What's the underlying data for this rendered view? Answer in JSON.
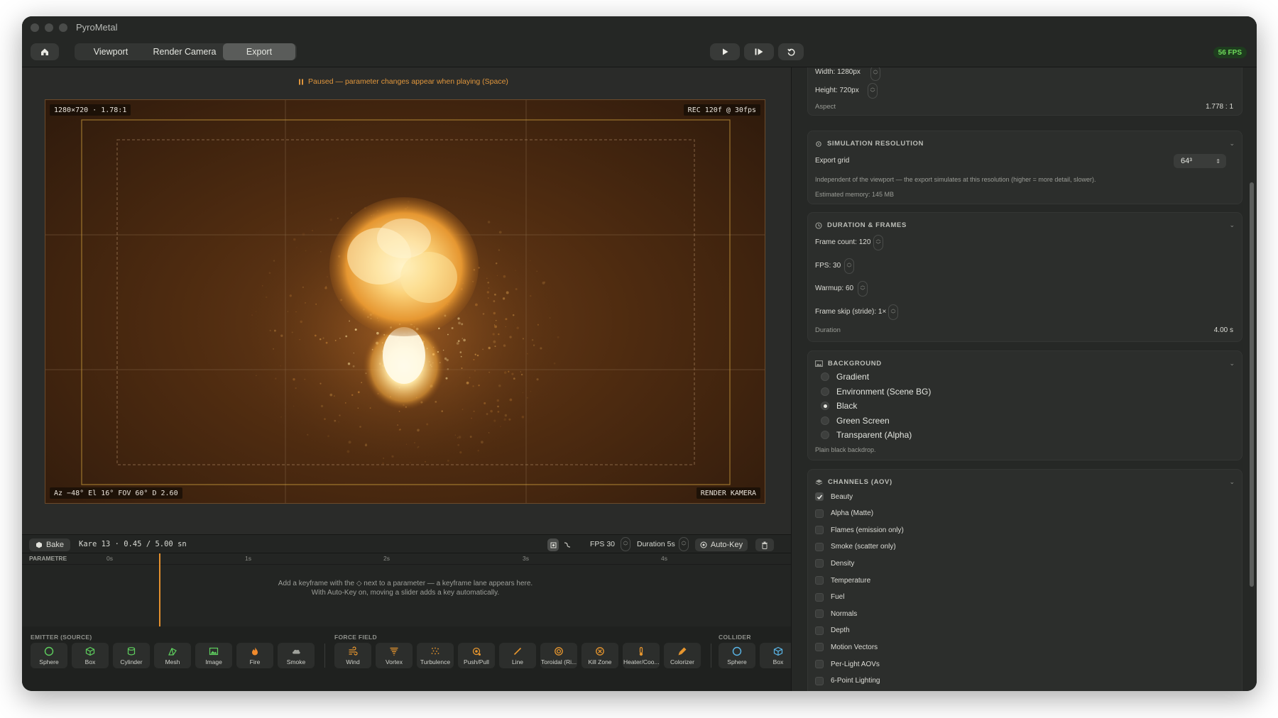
{
  "window": {
    "title": "PyroMetal"
  },
  "toolbar": {
    "tabs": [
      {
        "label": "Viewport"
      },
      {
        "label": "Render Camera"
      },
      {
        "label": "Export"
      }
    ],
    "active_tab": "Export",
    "fps_badge": "56 FPS"
  },
  "viewport": {
    "paused_banner": "Paused — parameter changes appear when playing (Space)",
    "resolution_tag": "1280×720  ·  1.78:1",
    "rec_tag": "REC 120f @ 30fps",
    "camera_readout": "Az −48°  El 16°  FOV 60°  D 2.60",
    "camera_tag": "RENDER KAMERA"
  },
  "timeline": {
    "bake_label": "Bake",
    "frame_info": "Kare 13 · 0.45 / 5.00 sn",
    "fps_label": "FPS 30",
    "duration_label": "Duration 5s",
    "autokey_label": "Auto-Key",
    "track_header": "PARAMETRE",
    "ticks": [
      "0s",
      "1s",
      "2s",
      "3s",
      "4s"
    ],
    "hint_line1": "Add a keyframe with the ◇ next to a parameter — a keyframe lane appears here.",
    "hint_line2": "With Auto-Key on, moving a slider adds a key automatically."
  },
  "dock": {
    "emitter_title": "EMITTER (SOURCE)",
    "force_title": "FORCE FIELD",
    "collider_title": "COLLIDER",
    "emitters": [
      {
        "label": "Sphere",
        "icon": "sphere-icon",
        "color": "#5ecf5e"
      },
      {
        "label": "Box",
        "icon": "box-icon",
        "color": "#5ecf5e"
      },
      {
        "label": "Cylinder",
        "icon": "cylinder-icon",
        "color": "#5ecf5e"
      },
      {
        "label": "Mesh",
        "icon": "mesh-icon",
        "color": "#5ecf5e"
      },
      {
        "label": "Image",
        "icon": "image-icon",
        "color": "#5ecf5e"
      },
      {
        "label": "Fire",
        "icon": "fire-icon",
        "color": "#f08a2c"
      },
      {
        "label": "Smoke",
        "icon": "cloud-icon",
        "color": "#a0a29c"
      }
    ],
    "forces": [
      {
        "label": "Wind",
        "icon": "wind-icon",
        "color": "#e7962e"
      },
      {
        "label": "Vortex",
        "icon": "tornado-icon",
        "color": "#e7962e"
      },
      {
        "label": "Turbulence",
        "icon": "turbulence-icon",
        "color": "#e7962e"
      },
      {
        "label": "Push/Pull",
        "icon": "push-pull-icon",
        "color": "#e7962e"
      },
      {
        "label": "Line",
        "icon": "line-icon",
        "color": "#e7962e"
      },
      {
        "label": "Toroidal (Ri...",
        "icon": "torus-icon",
        "color": "#e7962e"
      },
      {
        "label": "Kill Zone",
        "icon": "kill-zone-icon",
        "color": "#e7962e"
      },
      {
        "label": "Heater/Coo...",
        "icon": "heater-icon",
        "color": "#e7962e"
      },
      {
        "label": "Colorizer",
        "icon": "colorizer-icon",
        "color": "#e7962e"
      }
    ],
    "colliders": [
      {
        "label": "Sphere",
        "icon": "sphere-icon",
        "color": "#5ab6e8"
      },
      {
        "label": "Box",
        "icon": "box-icon",
        "color": "#5ab6e8"
      }
    ]
  },
  "panel": {
    "size": {
      "width_label": "Width: 1280px",
      "height_label": "Height: 720px",
      "aspect_label": "Aspect",
      "aspect_value": "1.778 : 1"
    },
    "simulation": {
      "title": "SIMULATION RESOLUTION",
      "grid_label": "Export grid",
      "grid_value": "64³",
      "description": "Independent of the viewport — the export simulates at this resolution (higher = more detail, slower).",
      "memory": "Estimated memory: 145 MB"
    },
    "duration": {
      "title": "DURATION & FRAMES",
      "frame_count": "Frame count: 120",
      "fps": "FPS: 30",
      "warmup": "Warmup: 60",
      "frame_skip": "Frame skip (stride): 1×",
      "duration_label": "Duration",
      "duration_value": "4.00 s"
    },
    "background": {
      "title": "BACKGROUND",
      "options": [
        "Gradient",
        "Environment (Scene BG)",
        "Black",
        "Green Screen",
        "Transparent (Alpha)"
      ],
      "selected": "Black",
      "note": "Plain black backdrop."
    },
    "channels": {
      "title": "CHANNELS (AOV)",
      "items": [
        {
          "label": "Beauty",
          "checked": true
        },
        {
          "label": "Alpha (Matte)",
          "checked": false
        },
        {
          "label": "Flames (emission only)",
          "checked": false
        },
        {
          "label": "Smoke (scatter only)",
          "checked": false
        },
        {
          "label": "Density",
          "checked": false
        },
        {
          "label": "Temperature",
          "checked": false
        },
        {
          "label": "Fuel",
          "checked": false
        },
        {
          "label": "Normals",
          "checked": false
        },
        {
          "label": "Depth",
          "checked": false
        },
        {
          "label": "Motion Vectors",
          "checked": false
        },
        {
          "label": "Per-Light AOVs",
          "checked": false
        },
        {
          "label": "6-Point Lighting",
          "checked": false
        }
      ]
    }
  }
}
